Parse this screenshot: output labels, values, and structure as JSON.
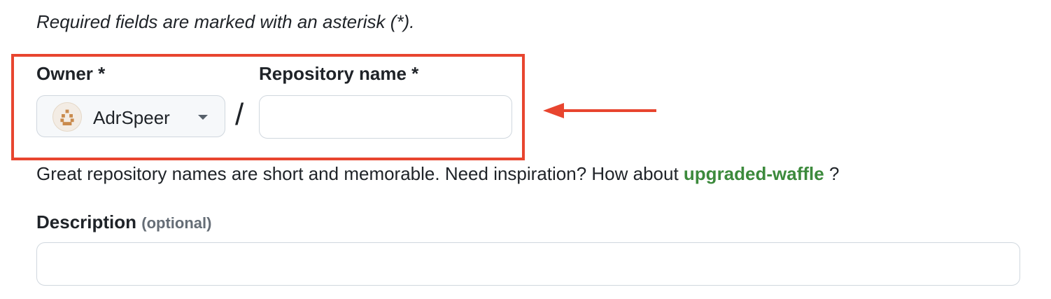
{
  "form": {
    "required_note": "Required fields are marked with an asterisk (*).",
    "owner": {
      "label": "Owner *",
      "selected": "AdrSpeer",
      "avatar_icon": "identicon-avatar",
      "caret_icon": "caret-down-icon"
    },
    "separator": "/",
    "repository_name": {
      "label": "Repository name *",
      "value": ""
    },
    "hint": {
      "prefix": "Great repository names are short and memorable. Need inspiration? How about ",
      "suggestion": "upgraded-waffle",
      "suffix": " ?"
    },
    "description": {
      "label": "Description",
      "optional_tag": "(optional)",
      "value": ""
    }
  },
  "annotation": {
    "highlight_color": "#e8452f",
    "arrow_icon": "left-arrow-annotation"
  },
  "colors": {
    "suggestion": "#3c8a3c",
    "border": "#d0d7de",
    "muted": "#656d76"
  }
}
